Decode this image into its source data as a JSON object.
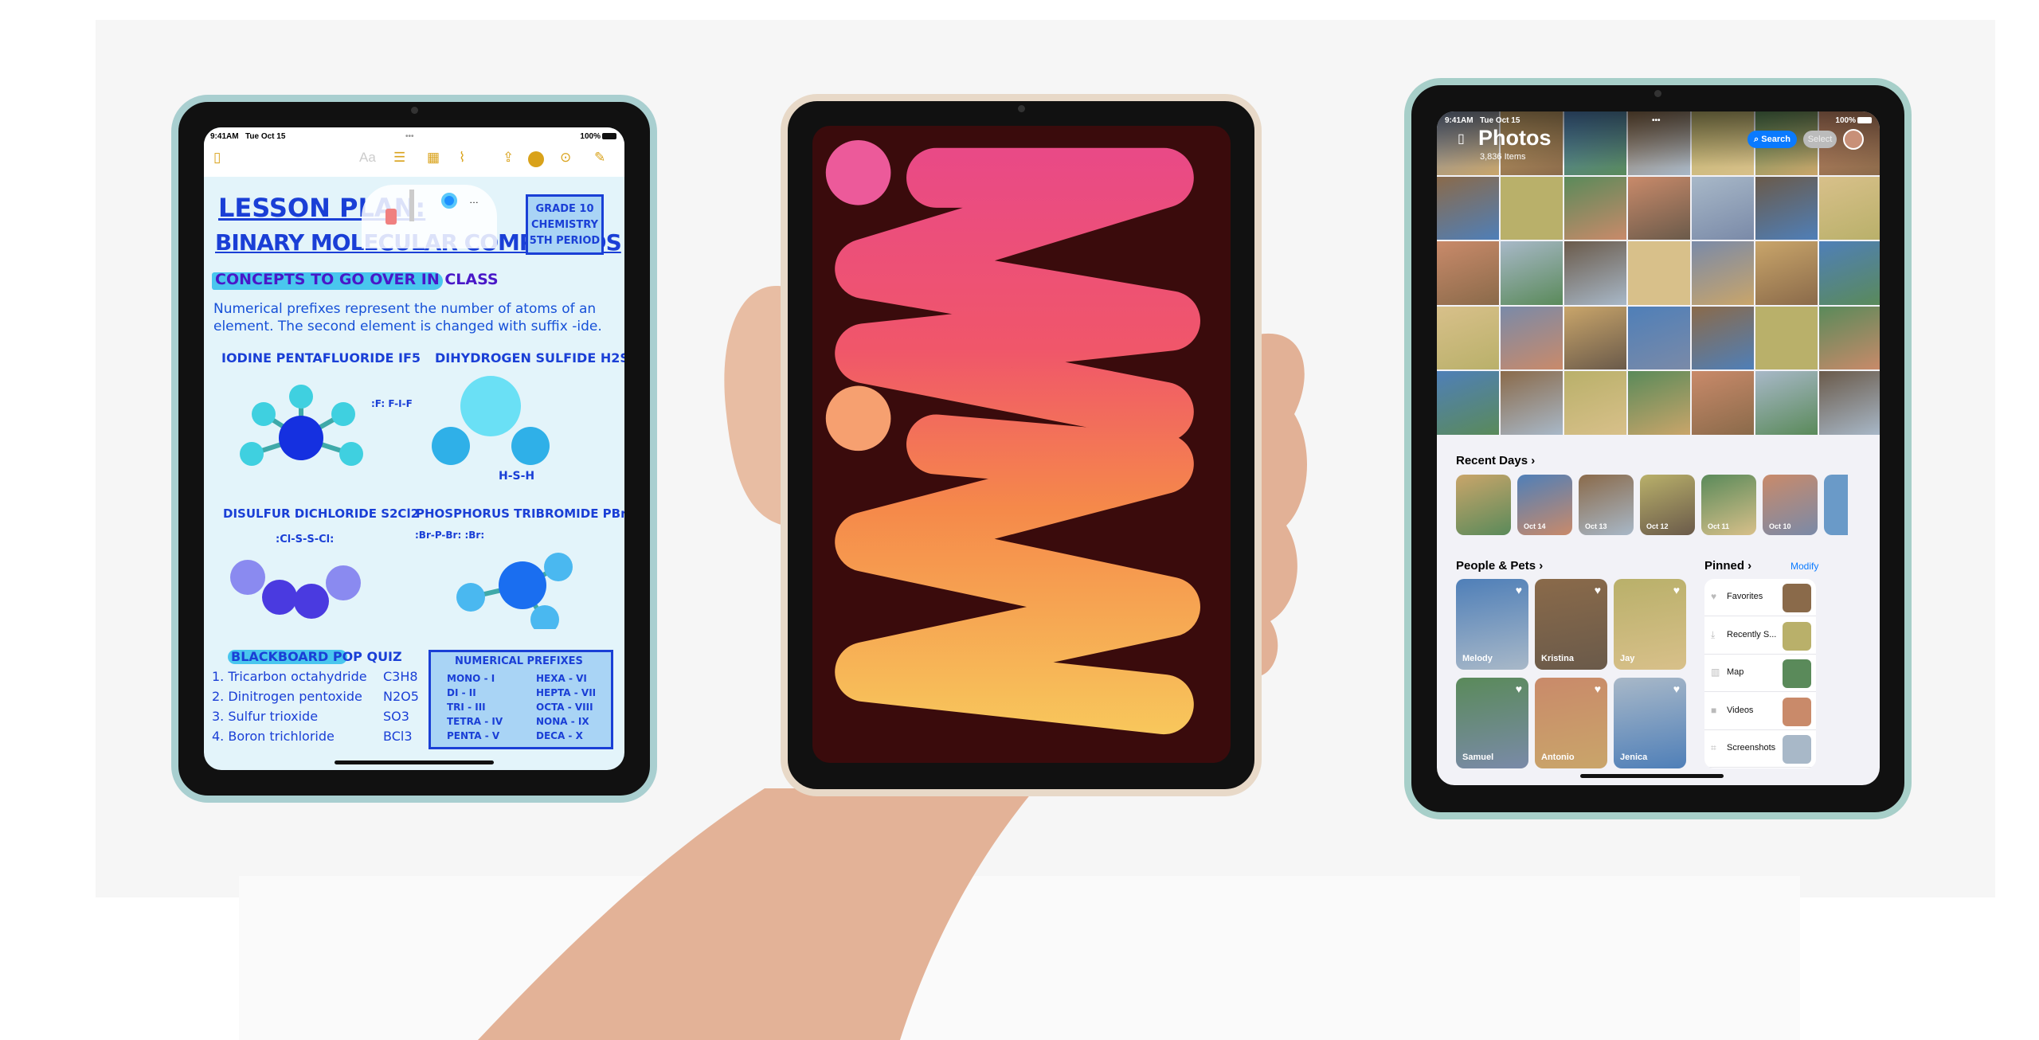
{
  "notes_ipad": {
    "status": {
      "time": "9:41AM",
      "date": "Tue Oct 15",
      "battery": "100%"
    },
    "toolbar": {
      "format": "Aa",
      "icons": [
        "sidebar-icon",
        "checklist-icon",
        "table-icon",
        "paperclip-icon",
        "share-icon",
        "markup-icon",
        "more-icon",
        "compose-icon"
      ]
    },
    "title_line1": "LESSON PLAN:",
    "title_line2": "BINARY MOLECULAR COMPOUNDS",
    "grade_box": [
      "GRADE 10",
      "CHEMISTRY",
      "5TH PERIOD"
    ],
    "concepts_heading": "CONCEPTS TO GO OVER IN CLASS",
    "concepts_text": [
      "Numerical prefixes represent the number of atoms of an",
      "element. The second element is changed with suffix -ide."
    ],
    "compounds": [
      {
        "name": "IODINE PENTAFLUORIDE IF5",
        "formula": ":F: F-I-F"
      },
      {
        "name": "DIHYDROGEN SULFIDE H2S",
        "formula": "H-S-H"
      },
      {
        "name": "DISULFUR DICHLORIDE S2Cl2",
        "formula": ":Cl-S-S-Cl:"
      },
      {
        "name": "PHOSPHORUS TRIBROMIDE PBr3",
        "formula": ":Br-P-Br: :Br:"
      }
    ],
    "quiz_heading": "BLACKBOARD POP QUIZ",
    "quiz_items": [
      {
        "q": "1. Tricarbon octahydride",
        "a": "C3H8"
      },
      {
        "q": "2. Dinitrogen pentoxide",
        "a": "N2O5"
      },
      {
        "q": "3. Sulfur trioxide",
        "a": "SO3"
      },
      {
        "q": "4. Boron trichloride",
        "a": "BCl3"
      }
    ],
    "prefixes_heading": "NUMERICAL PREFIXES",
    "prefixes": [
      "MONO - I",
      "DI - II",
      "TRI - III",
      "TETRA - IV",
      "PENTA - V",
      "HEXA - VI",
      "HEPTA - VII",
      "OCTA - VIII",
      "NONA - IX",
      "DECA - X"
    ],
    "colors": {
      "ink": "#1a3fd6",
      "paper": "#e3f4fa",
      "accent": "#d9a21a"
    }
  },
  "wallpaper_ipad": {
    "colors": {
      "background": "#3a0b0c",
      "pink": "#f2508a",
      "orange": "#f57a48",
      "yellow": "#f8cf5e"
    }
  },
  "photos_ipad": {
    "status": {
      "time": "9:41AM",
      "date": "Tue Oct 15",
      "battery": "100%"
    },
    "title": "Photos",
    "count": "3,836 Items",
    "search_label": "Search",
    "select_label": "Select",
    "recent_days": {
      "heading": "Recent Days",
      "items": [
        "",
        "Oct 14",
        "Oct 13",
        "Oct 12",
        "Oct 11",
        "Oct 10"
      ]
    },
    "people": {
      "heading": "People & Pets",
      "items": [
        "Melody",
        "Kristina",
        "Jay",
        "Samuel",
        "Antonio",
        "Jenica"
      ]
    },
    "pinned": {
      "heading": "Pinned",
      "modify": "Modify",
      "items": [
        "Favorites",
        "Recently S...",
        "Map",
        "Videos",
        "Screenshots"
      ]
    },
    "colors": {
      "accent": "#0a7aff",
      "panel": "#f2f2f7"
    },
    "tile_palette": [
      "#7a8aa8",
      "#c9a56a",
      "#4f7fb8",
      "#8a6a4a",
      "#b9b06a",
      "#5a8a5a",
      "#c98a6a",
      "#a8b8c8",
      "#6a5a4a",
      "#d8c08a"
    ]
  }
}
